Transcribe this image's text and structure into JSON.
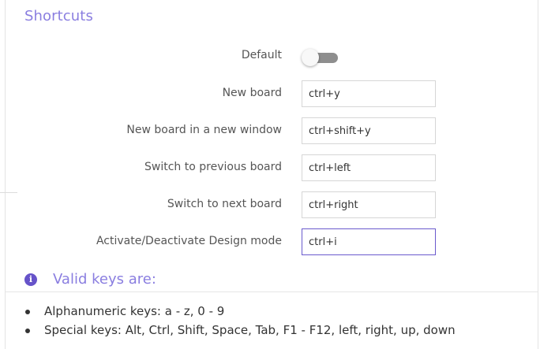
{
  "section": {
    "title": "Shortcuts"
  },
  "default_toggle": {
    "label": "Default",
    "enabled": false
  },
  "shortcuts": [
    {
      "label": "New board",
      "value": "ctrl+y",
      "focused": false
    },
    {
      "label": "New board in a new window",
      "value": "ctrl+shift+y",
      "focused": false
    },
    {
      "label": "Switch to previous board",
      "value": "ctrl+left",
      "focused": false
    },
    {
      "label": "Switch to next board",
      "value": "ctrl+right",
      "focused": false
    },
    {
      "label": "Activate/Deactivate Design mode",
      "value": "ctrl+i",
      "focused": true
    }
  ],
  "valid_keys": {
    "icon": "info-circle-icon",
    "title": "Valid keys are:",
    "items": [
      "Alphanumeric keys: a - z, 0 - 9",
      "Special keys: Alt, Ctrl, Shift, Space, Tab, F1 - F12, left, right, up, down"
    ]
  },
  "colors": {
    "accent": "#8a7ee0",
    "focus_border": "#6a5acd",
    "info_icon": "#6653c9",
    "toggle_track": "#8e8e8e"
  }
}
